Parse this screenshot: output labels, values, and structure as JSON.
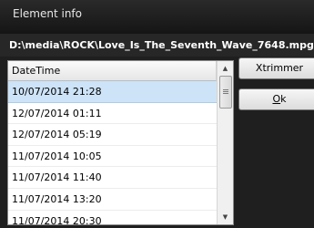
{
  "window": {
    "title": "Element info"
  },
  "file_path": "D:\\media\\ROCK\\Love_Is_The_Seventh_Wave_7648.mpg",
  "list": {
    "header": "DateTime",
    "rows": [
      "10/07/2014 21:28",
      "12/07/2014 01:11",
      "12/07/2014 05:19",
      "11/07/2014 10:05",
      "11/07/2014 11:40",
      "11/07/2014 13:20",
      "11/07/2014 20:30"
    ],
    "selected_index": 0
  },
  "buttons": {
    "xtrimmer": "Xtrimmer",
    "ok_mnemonic": "O",
    "ok_rest": "k"
  },
  "icons": {
    "scroll_up": "triangle-up",
    "scroll_down": "triangle-down"
  }
}
